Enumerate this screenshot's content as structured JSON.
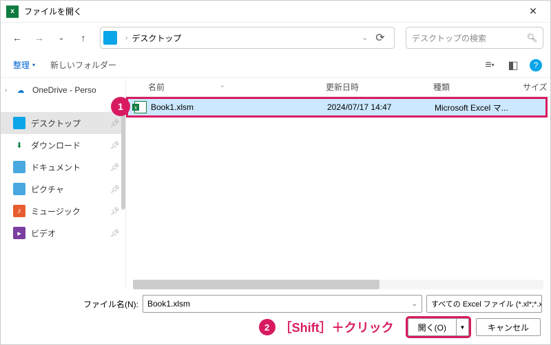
{
  "titlebar": {
    "title": "ファイルを開く"
  },
  "nav": {
    "location": "デスクトップ",
    "search_placeholder": "デスクトップの検索"
  },
  "toolbar": {
    "organize": "整理",
    "newfolder": "新しいフォルダー"
  },
  "sidebar": {
    "onedrive": "OneDrive - Perso",
    "items": [
      {
        "label": "デスクトップ"
      },
      {
        "label": "ダウンロード"
      },
      {
        "label": "ドキュメント"
      },
      {
        "label": "ピクチャ"
      },
      {
        "label": "ミュージック"
      },
      {
        "label": "ビデオ"
      }
    ]
  },
  "columns": {
    "name": "名前",
    "date": "更新日時",
    "type": "種類",
    "size": "サイズ"
  },
  "files": [
    {
      "name": "Book1.xlsm",
      "date": "2024/07/17 14:47",
      "type": "Microsoft Excel マ..."
    }
  ],
  "footer": {
    "filename_label": "ファイル名(N):",
    "filename_value": "Book1.xlsm",
    "filter": "すべての Excel ファイル (*.xl*;*.xlsx;",
    "open": "開く(O)",
    "cancel": "キャンセル"
  },
  "annotations": {
    "marker1": "1",
    "marker2": "2",
    "text2": "［Shift］＋クリック"
  }
}
